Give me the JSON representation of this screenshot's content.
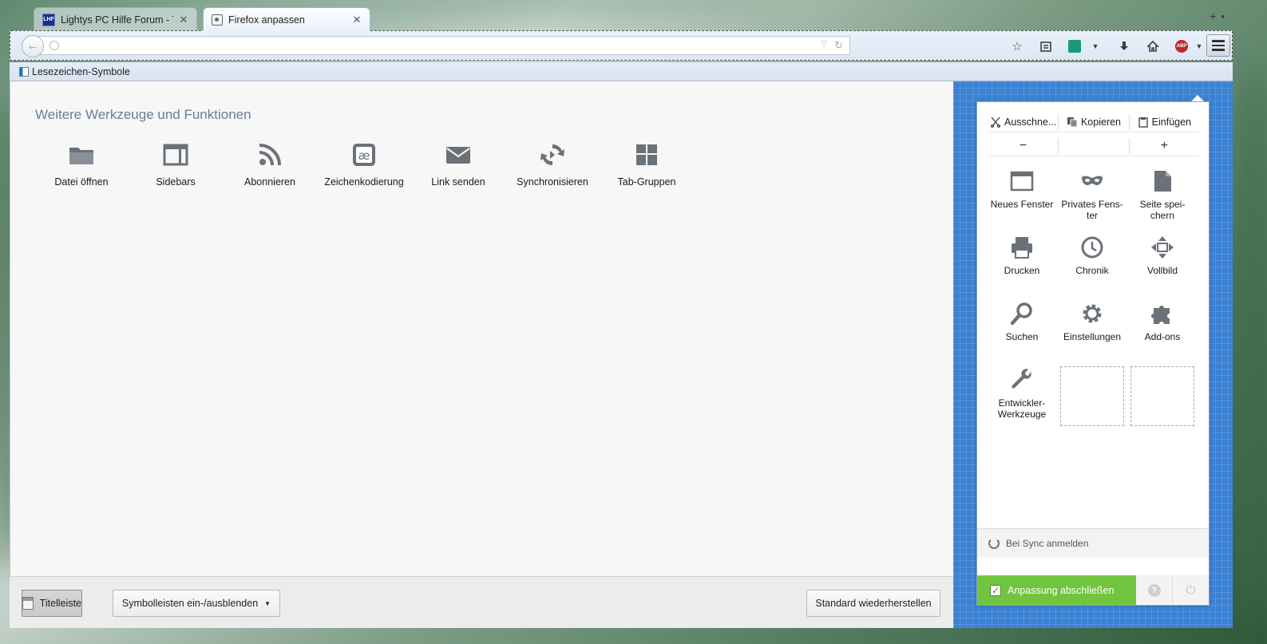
{
  "tabs": [
    {
      "label": "Lightys PC Hilfe Forum - T...",
      "favicon": "LHF",
      "state": "inactive"
    },
    {
      "label": "Firefox anpassen",
      "state": "active"
    }
  ],
  "navbar": {
    "url_value": ""
  },
  "bookmarks": {
    "item": "Lesezeichen-Symbole"
  },
  "main": {
    "title": "Weitere Werkzeuge und Funktionen",
    "palette": [
      {
        "label": "Datei öffnen",
        "icon": "folder-icon"
      },
      {
        "label": "Sidebars",
        "icon": "sidebar-icon"
      },
      {
        "label": "Abonnieren",
        "icon": "rss-icon"
      },
      {
        "label": "Zeichenkodierung",
        "icon": "encoding-icon"
      },
      {
        "label": "Link senden",
        "icon": "envelope-icon"
      },
      {
        "label": "Synchronisieren",
        "icon": "sync-icon"
      },
      {
        "label": "Tab-Gruppen",
        "icon": "tab-groups-icon"
      }
    ]
  },
  "footer": {
    "titlebar": "Titelleiste",
    "toolbars": "Symbolleisten ein-/ausblenden",
    "restore": "Standard wiederherstellen"
  },
  "panel": {
    "edit": {
      "cut": "Ausschne...",
      "copy": "Kopieren",
      "paste": "Einfügen"
    },
    "zoom": {
      "out": "−",
      "reset": "",
      "in": "+"
    },
    "items": [
      {
        "line1": "Neues Fenster",
        "line2": "",
        "icon": "window-icon"
      },
      {
        "line1": "Privates Fens-",
        "line2": "ter",
        "icon": "mask-icon"
      },
      {
        "line1": "Seite spei-",
        "line2": "chern",
        "icon": "page-icon"
      },
      {
        "line1": "Drucken",
        "line2": "",
        "icon": "printer-icon"
      },
      {
        "line1": "Chronik",
        "line2": "",
        "icon": "clock-icon"
      },
      {
        "line1": "Vollbild",
        "line2": "",
        "icon": "fullscreen-icon"
      },
      {
        "line1": "Suchen",
        "line2": "",
        "icon": "search-icon"
      },
      {
        "line1": "Einstellungen",
        "line2": "",
        "icon": "gear-icon"
      },
      {
        "line1": "Add-ons",
        "line2": "",
        "icon": "puzzle-icon"
      },
      {
        "line1": "Entwickler-",
        "line2": "Werkzeuge",
        "icon": "wrench-icon"
      }
    ],
    "sync": "Bei Sync anmelden",
    "done": "Anpassung abschließen"
  },
  "colors": {
    "accent_blue": "#3b82d4",
    "done_green": "#71c43d",
    "icon_gray": "#6b7178"
  }
}
